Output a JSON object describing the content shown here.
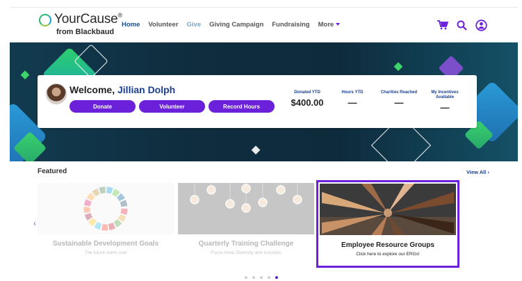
{
  "brand": {
    "name": "YourCause",
    "reg": "®",
    "sub": "from Blackbaud"
  },
  "nav": {
    "items": [
      {
        "label": "Home"
      },
      {
        "label": "Volunteer"
      },
      {
        "label": "Give"
      },
      {
        "label": "Giving Campaign"
      },
      {
        "label": "Fundraising"
      },
      {
        "label": "More"
      }
    ]
  },
  "icons": {
    "cart": "cart-icon",
    "search": "search-icon",
    "account": "account-icon",
    "accent_color": "#6b21d9"
  },
  "welcome": {
    "greeting": "Welcome, ",
    "name": "Jillian Dolph",
    "buttons": [
      {
        "label": "Donate"
      },
      {
        "label": "Volunteer"
      },
      {
        "label": "Record Hours"
      }
    ]
  },
  "stats": [
    {
      "label": "Donated YTD",
      "value": "$400.00"
    },
    {
      "label": "Hours YTD",
      "value": "—"
    },
    {
      "label": "Charities Reached",
      "value": "—"
    },
    {
      "label": "My Incentives Available",
      "value": "—"
    }
  ],
  "featured": {
    "title": "Featured",
    "view_all": "View All",
    "cards": [
      {
        "title": "Sustainable Development Goals",
        "subtitle": "The future starts now"
      },
      {
        "title": "Quarterly Training Challenge",
        "subtitle": "Focus Area: Diversity and Inclusion"
      },
      {
        "title": "Employee Resource Groups",
        "subtitle": "Click here to explore our ERGs!"
      }
    ],
    "carousel": {
      "page_count": 5,
      "active_page": 5
    }
  }
}
